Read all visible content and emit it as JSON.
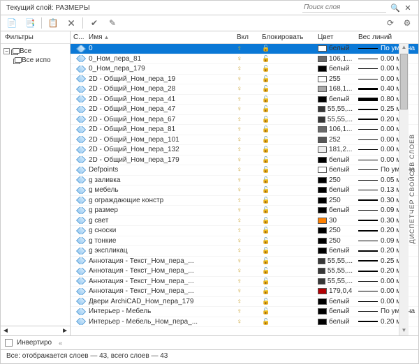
{
  "header": {
    "current_layer_label": "Текущий слой: РАЗМЕРЫ",
    "search_placeholder": "Поиск слоя"
  },
  "left": {
    "header": "Фильтры",
    "all": "Все",
    "used": "Все испо"
  },
  "columns": {
    "s": "С...",
    "name": "Имя",
    "on": "Вкл",
    "lock": "Блокировать",
    "color": "Цвет",
    "weight": "Вес линий"
  },
  "footer": {
    "invert": "Инвертиро"
  },
  "status": "Все: отображается слоев — 43, всего слоев — 43",
  "side": "ДИСПЕТЧЕР СВОЙСТВ СЛОЕВ",
  "layers": [
    {
      "name": "0",
      "color": "белый",
      "sw": "#ffffff",
      "wt": "По умолча",
      "th": 1,
      "sel": true
    },
    {
      "name": "0_Ном_пера_81",
      "color": "106,1...",
      "sw": "#6a6a6a",
      "wt": "0.00 мм",
      "th": 1
    },
    {
      "name": "0_Ном_пера_179",
      "color": "белый",
      "sw": "#000000",
      "wt": "0.00 мм",
      "th": 1
    },
    {
      "name": "2D - Общий_Ном_пера_19",
      "color": "255",
      "sw": "#ffffff",
      "wt": "0.00 мм",
      "th": 1
    },
    {
      "name": "2D - Общий_Ном_пера_28",
      "color": "168,1...",
      "sw": "#a8a8a8",
      "wt": "0.40 мм",
      "th": 3
    },
    {
      "name": "2D - Общий_Ном_пера_41",
      "color": "белый",
      "sw": "#000000",
      "wt": "0.80 мм",
      "th": 5
    },
    {
      "name": "2D - Общий_Ном_пера_47",
      "color": "55,55,...",
      "sw": "#373737",
      "wt": "0.25 мм",
      "th": 2
    },
    {
      "name": "2D - Общий_Ном_пера_67",
      "color": "55,55,...",
      "sw": "#373737",
      "wt": "0.20 мм",
      "th": 2
    },
    {
      "name": "2D - Общий_Ном_пера_81",
      "color": "106,1...",
      "sw": "#6a6a6a",
      "wt": "0.00 мм",
      "th": 1
    },
    {
      "name": "2D - Общий_Ном_пера_101",
      "color": "252",
      "sw": "#555555",
      "wt": "0.00 мм",
      "th": 1
    },
    {
      "name": "2D - Общий_Ном_пера_132",
      "color": "181,2...",
      "sw": "#eeeeee",
      "wt": "0.00 мм",
      "th": 1
    },
    {
      "name": "2D - Общий_Ном_пера_179",
      "color": "белый",
      "sw": "#000000",
      "wt": "0.00 мм",
      "th": 1
    },
    {
      "name": "Defpoints",
      "color": "белый",
      "sw": "#ffffff",
      "wt": "По умолча",
      "th": 1
    },
    {
      "name": "g заливка",
      "color": "250",
      "sw": "#000000",
      "wt": "0.05 мм",
      "th": 1
    },
    {
      "name": "g мебель",
      "color": "белый",
      "sw": "#000000",
      "wt": "0.13 мм",
      "th": 1
    },
    {
      "name": "g ограждающие констр",
      "color": "250",
      "sw": "#000000",
      "wt": "0.30 мм",
      "th": 2
    },
    {
      "name": "g размер",
      "color": "белый",
      "sw": "#000000",
      "wt": "0.09 мм",
      "th": 1
    },
    {
      "name": "g свет",
      "color": "30",
      "sw": "#ff8000",
      "wt": "0.30 мм",
      "th": 2
    },
    {
      "name": "g сноски",
      "color": "250",
      "sw": "#000000",
      "wt": "0.20 мм",
      "th": 2
    },
    {
      "name": "g тонкие",
      "color": "250",
      "sw": "#000000",
      "wt": "0.09 мм",
      "th": 1
    },
    {
      "name": "g экспликац",
      "color": "белый",
      "sw": "#000000",
      "wt": "0.20 мм",
      "th": 2
    },
    {
      "name": "Аннотация - Текст_Ном_пера_...",
      "color": "55,55,...",
      "sw": "#373737",
      "wt": "0.25 мм",
      "th": 2
    },
    {
      "name": "Аннотация - Текст_Ном_пера_...",
      "color": "55,55,...",
      "sw": "#373737",
      "wt": "0.20 мм",
      "th": 2
    },
    {
      "name": "Аннотация - Текст_Ном_пера_...",
      "color": "55,55,...",
      "sw": "#373737",
      "wt": "0.00 мм",
      "th": 1
    },
    {
      "name": "Аннотация - Текст_Ном_пера_...",
      "color": "179,0,4",
      "sw": "#b30004",
      "wt": "0.00 мм",
      "th": 1
    },
    {
      "name": "Двери ArchiCAD_Ном_пера_179",
      "color": "белый",
      "sw": "#000000",
      "wt": "0.00 мм",
      "th": 1
    },
    {
      "name": "Интерьер - Мебель",
      "color": "белый",
      "sw": "#000000",
      "wt": "По умолча",
      "th": 1
    },
    {
      "name": "Интерьер - Мебель_Ном_пера_...",
      "color": "белый",
      "sw": "#000000",
      "wt": "0.20 мм",
      "th": 2
    }
  ]
}
